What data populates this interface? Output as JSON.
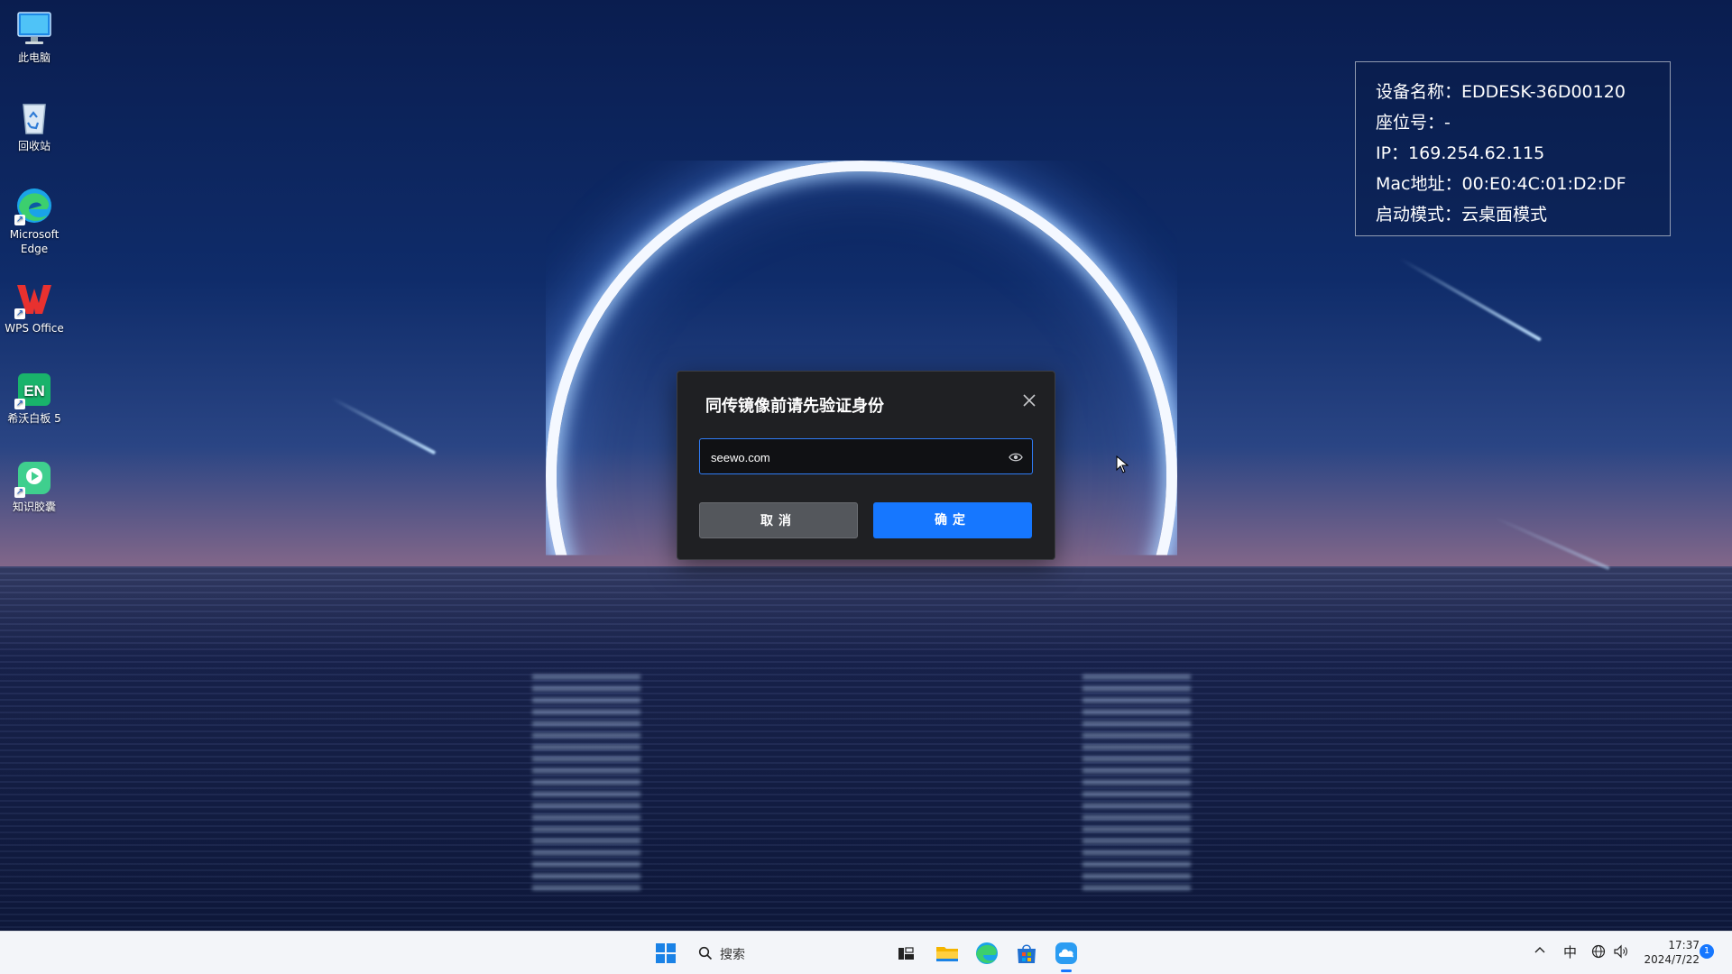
{
  "desktop": {
    "icons": [
      {
        "label": "此电脑"
      },
      {
        "label": "回收站"
      },
      {
        "label": "Microsoft Edge"
      },
      {
        "label": "WPS Office"
      },
      {
        "label": "希沃白板 5"
      },
      {
        "label": "知识胶囊"
      }
    ]
  },
  "info_panel": {
    "device_name": "设备名称：EDDESK-36D00120",
    "seat_no": "座位号：-",
    "ip": "IP：169.254.62.115",
    "mac": "Mac地址：00:E0:4C:01:D2:DF",
    "boot_mode": "启动模式：云桌面模式"
  },
  "dialog": {
    "title": "同传镜像前请先验证身份",
    "password_value": "seewo.com",
    "cancel_label": "取消",
    "ok_label": "确定"
  },
  "taskbar": {
    "search_label": "搜索",
    "ime": "中",
    "time": "17:37",
    "date": "2024/7/22",
    "notification_count": "1"
  },
  "colors": {
    "accent": "#1677ff",
    "dialog_bg": "#1f2023",
    "taskbar_bg": "#f3f5f9"
  }
}
